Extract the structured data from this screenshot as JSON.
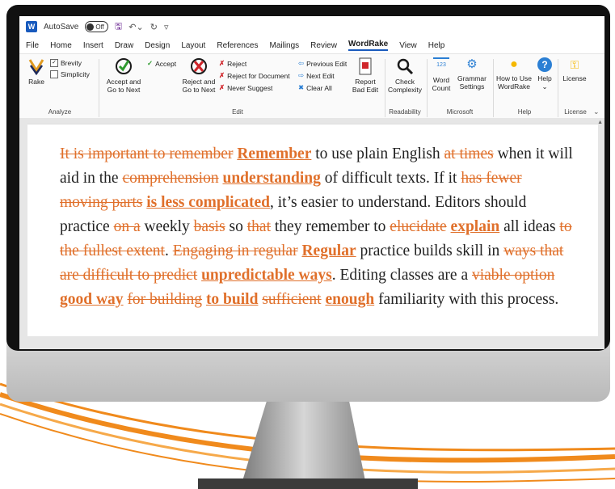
{
  "titlebar": {
    "autosave_label": "AutoSave",
    "autosave_state": "Off",
    "customize_symbol": "▿"
  },
  "menu": [
    "File",
    "Home",
    "Insert",
    "Draw",
    "Design",
    "Layout",
    "References",
    "Mailings",
    "Review",
    "WordRake",
    "View",
    "Help"
  ],
  "menu_active": "WordRake",
  "ribbon": {
    "analyze": {
      "group": "Analyze",
      "rake": "Rake",
      "brevity": "Brevity",
      "simplicity": "Simplicity",
      "brevity_checked": true,
      "simplicity_checked": false
    },
    "edit": {
      "group": "Edit",
      "accept": "Accept",
      "accept_next_1": "Accept and",
      "accept_next_2": "Go to Next",
      "reject_next_1": "Reject and",
      "reject_next_2": "Go to Next",
      "reject": "Reject",
      "reject_doc": "Reject for Document",
      "never_suggest": "Never Suggest",
      "previous_edit": "Previous Edit",
      "next_edit": "Next Edit",
      "clear_all": "Clear All",
      "report_1": "Report",
      "report_2": "Bad Edit"
    },
    "readability": {
      "group": "Readability",
      "check_1": "Check",
      "check_2": "Complexity"
    },
    "microsoft": {
      "group": "Microsoft",
      "word_count_1": "Word",
      "word_count_2": "Count",
      "word_count_icon_text": "123",
      "grammar_1": "Grammar",
      "grammar_2": "Settings"
    },
    "help": {
      "group": "Help",
      "howto_1": "How to Use",
      "howto_2": "WordRake",
      "help": "Help"
    },
    "license": {
      "group": "License",
      "license": "License"
    }
  },
  "document": {
    "segments": [
      {
        "t": "del",
        "s": "It is important to remember"
      },
      {
        "t": "n",
        "s": " "
      },
      {
        "t": "ins",
        "s": "Remember"
      },
      {
        "t": "n",
        "s": " to use plain English "
      },
      {
        "t": "del",
        "s": "at times"
      },
      {
        "t": "n",
        "s": " when it will aid in the "
      },
      {
        "t": "del",
        "s": "comprehension"
      },
      {
        "t": "n",
        "s": " "
      },
      {
        "t": "ins",
        "s": "understanding"
      },
      {
        "t": "n",
        "s": " of difficult texts. If it "
      },
      {
        "t": "del",
        "s": "has fewer moving parts"
      },
      {
        "t": "n",
        "s": " "
      },
      {
        "t": "ins",
        "s": "is less complicated"
      },
      {
        "t": "n",
        "s": ", it’s easier to understand. Editors should practice "
      },
      {
        "t": "del",
        "s": "on a"
      },
      {
        "t": "n",
        "s": " weekly "
      },
      {
        "t": "del",
        "s": "basis"
      },
      {
        "t": "n",
        "s": " so "
      },
      {
        "t": "del",
        "s": "that"
      },
      {
        "t": "n",
        "s": " they remember to "
      },
      {
        "t": "del",
        "s": "elucidate"
      },
      {
        "t": "n",
        "s": " "
      },
      {
        "t": "ins",
        "s": "explain"
      },
      {
        "t": "n",
        "s": " all ideas "
      },
      {
        "t": "del",
        "s": "to the fullest extent"
      },
      {
        "t": "n",
        "s": ". "
      },
      {
        "t": "del",
        "s": "Engaging in regular"
      },
      {
        "t": "n",
        "s": " "
      },
      {
        "t": "ins",
        "s": "Regular"
      },
      {
        "t": "n",
        "s": " practice builds skill in "
      },
      {
        "t": "del",
        "s": "ways that are difficult to predict"
      },
      {
        "t": "n",
        "s": " "
      },
      {
        "t": "ins",
        "s": "unpredictable ways"
      },
      {
        "t": "n",
        "s": ". Editing classes are a "
      },
      {
        "t": "del",
        "s": "viable option"
      },
      {
        "t": "n",
        "s": " "
      },
      {
        "t": "ins",
        "s": "good way"
      },
      {
        "t": "n",
        "s": " "
      },
      {
        "t": "del",
        "s": "for building"
      },
      {
        "t": "n",
        "s": " "
      },
      {
        "t": "ins",
        "s": "to build"
      },
      {
        "t": "n",
        "s": " "
      },
      {
        "t": "del",
        "s": "sufficient"
      },
      {
        "t": "n",
        "s": " "
      },
      {
        "t": "ins",
        "s": "enough"
      },
      {
        "t": "n",
        "s": " familiarity with this process."
      }
    ]
  },
  "colors": {
    "edit_orange": "#e0702b",
    "word_blue": "#185abd",
    "monitor_bezel": "#111111",
    "swoosh_orange": "#f08a1c"
  }
}
